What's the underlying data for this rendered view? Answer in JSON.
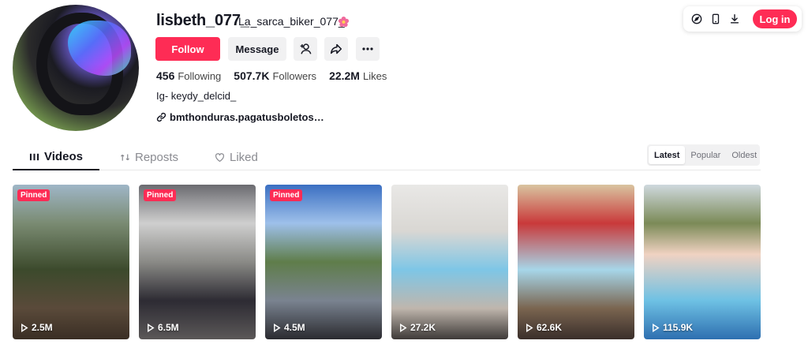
{
  "profile": {
    "username": "lisbeth_077_",
    "nickname": "La_sarca_biker_077_",
    "follow_label": "Follow",
    "message_label": "Message",
    "stats": {
      "following_count": "456",
      "following_label": "Following",
      "followers_count": "507.7K",
      "followers_label": "Followers",
      "likes_count": "22.2M",
      "likes_label": "Likes"
    },
    "bio": "Ig- keydy_delcid_",
    "link": "bmthonduras.pagatusboletos…"
  },
  "header": {
    "login_label": "Log in"
  },
  "tabs": [
    {
      "label": "Videos"
    },
    {
      "label": "Reposts"
    },
    {
      "label": "Liked"
    }
  ],
  "sort": {
    "options": [
      "Latest",
      "Popular",
      "Oldest"
    ],
    "selected": "Latest"
  },
  "videos": [
    {
      "pinned": "Pinned",
      "views": "2.5M"
    },
    {
      "pinned": "Pinned",
      "views": "6.5M"
    },
    {
      "pinned": "Pinned",
      "views": "4.5M"
    },
    {
      "views": "27.2K"
    },
    {
      "views": "62.6K"
    },
    {
      "views": "115.9K"
    }
  ],
  "colors": {
    "accent": "#fe2c55",
    "text": "#161823",
    "button_bg": "#f1f1f2"
  },
  "icons": [
    "flower-icon",
    "add-friend-icon",
    "share-icon",
    "more-icon",
    "compass-icon",
    "mobile-icon",
    "download-icon",
    "link-icon",
    "grid-icon",
    "repost-icon",
    "heart-icon",
    "play-icon"
  ]
}
